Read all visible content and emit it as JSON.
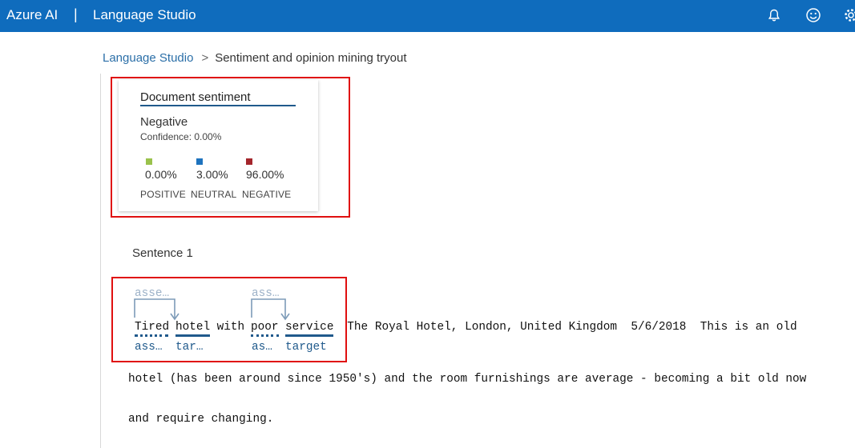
{
  "header": {
    "brand": "Azure AI",
    "separator": "|",
    "product": "Language Studio",
    "icons": [
      "bell-icon",
      "smiley-icon",
      "gear-icon"
    ]
  },
  "breadcrumb": {
    "root": "Language Studio",
    "chevron": ">",
    "current": "Sentiment and opinion mining tryout"
  },
  "document_sentiment": {
    "title": "Document sentiment",
    "label": "Negative",
    "confidence": "Confidence: 0.00%",
    "scores": [
      {
        "value": "0.00%",
        "category": "POSITIVE",
        "color": "#9ac24c"
      },
      {
        "value": "3.00%",
        "category": "NEUTRAL",
        "color": "#1e73be"
      },
      {
        "value": "96.00%",
        "category": "NEGATIVE",
        "color": "#a4262c"
      }
    ]
  },
  "sentence": {
    "label": "Sentence 1",
    "words": {
      "w1": "Tired",
      "w2": "hotel",
      "with": " with ",
      "w3": "poor",
      "w4": "service",
      "rest1": "  The Royal Hotel, London, United Kingdom  5/6/2018  This is an old"
    },
    "line2": "hotel (has been around since 1950's) and the room furnishings are average - becoming a bit old now",
    "line3": "and require changing.",
    "tags_below": {
      "t1": "ass…",
      "t2": "tar…",
      "t3": "as…",
      "t4": "target"
    },
    "tags_above": {
      "a1": "asse…",
      "a2": "ass…"
    }
  },
  "colors": {
    "topbar": "#0f6cbd",
    "accent": "#205a8c",
    "highlight_box": "#e01010"
  }
}
